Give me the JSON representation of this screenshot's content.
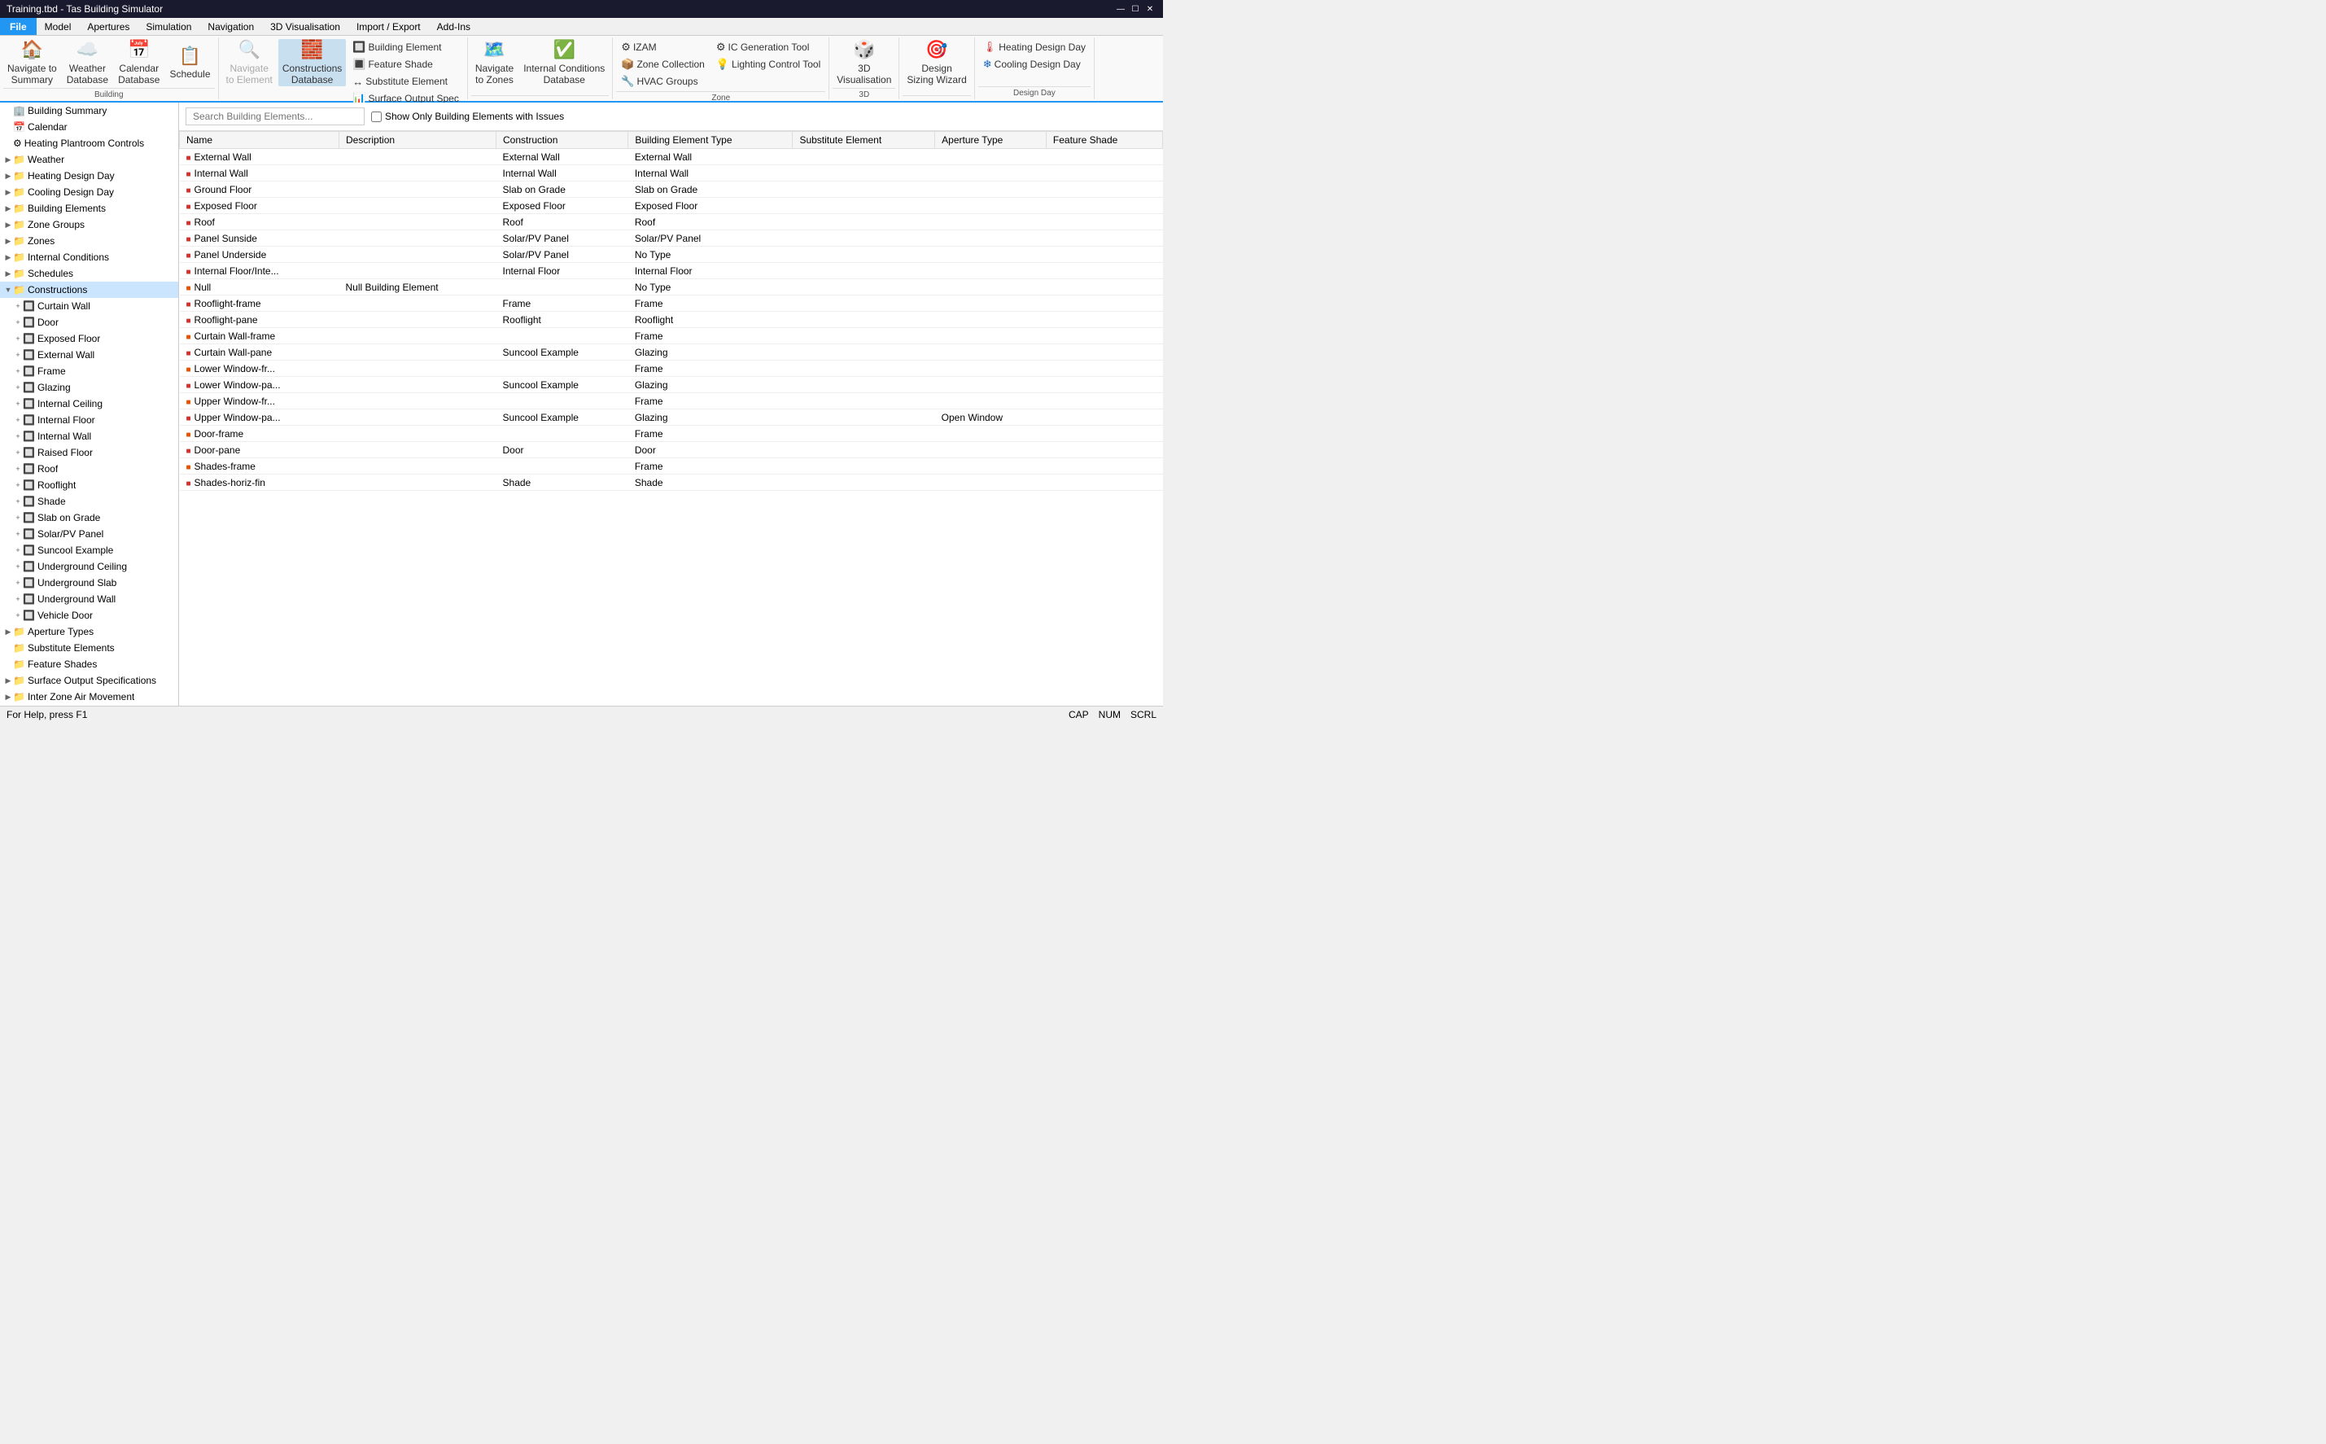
{
  "titlebar": {
    "title": "Training.tbd - Tas Building Simulator",
    "controls": [
      "—",
      "☐",
      "✕"
    ]
  },
  "menubar": {
    "file": "File",
    "items": [
      "Model",
      "Apertures",
      "Simulation",
      "Navigation",
      "3D Visualisation",
      "Import / Export",
      "Add-Ins"
    ]
  },
  "ribbon": {
    "groups": [
      {
        "label": "Building",
        "buttons": [
          {
            "id": "navigate-summary",
            "label": "Navigate to\nSummary",
            "icon": "🏠"
          },
          {
            "id": "weather",
            "label": "Weather\nDatabase",
            "icon": "☁"
          },
          {
            "id": "calendar",
            "label": "Calendar\nDatabase",
            "icon": "📅"
          },
          {
            "id": "schedule",
            "label": "Schedule",
            "icon": "📋"
          }
        ]
      },
      {
        "label": "Building Element",
        "buttons": [
          {
            "id": "navigate-element",
            "label": "Navigate\nto Element",
            "icon": "🔍",
            "disabled": false
          },
          {
            "id": "constructions-db",
            "label": "Constructions\nDatabase",
            "icon": "🧱",
            "active": true
          }
        ],
        "small_buttons": [
          {
            "id": "building-element",
            "label": "Building Element",
            "icon": "🔲"
          },
          {
            "id": "feature-shade",
            "label": "Feature Shade",
            "icon": "🔳"
          },
          {
            "id": "substitute-element",
            "label": "Substitute Element",
            "icon": "↔"
          },
          {
            "id": "surface-output-spec",
            "label": "Surface Output Spec",
            "icon": "📊"
          }
        ]
      },
      {
        "label": "",
        "buttons": [
          {
            "id": "navigate-zones",
            "label": "Navigate\nto Zones",
            "icon": "🗺"
          },
          {
            "id": "internal-conditions",
            "label": "Internal Conditions\nDatabase",
            "icon": "✅"
          }
        ]
      },
      {
        "label": "Zone",
        "small_buttons": [
          {
            "id": "izam",
            "label": "IZAM",
            "icon": "⚙"
          },
          {
            "id": "zone-collection",
            "label": "Zone Collection",
            "icon": "📦"
          },
          {
            "id": "hvac-groups",
            "label": "HVAC Groups",
            "icon": "🔧"
          },
          {
            "id": "ic-gen-tool",
            "label": "IC Generation Tool",
            "icon": "⚙"
          },
          {
            "id": "lighting-control",
            "label": "Lighting Control Tool",
            "icon": "💡"
          }
        ]
      },
      {
        "label": "3D",
        "buttons": [
          {
            "id": "3d-vis",
            "label": "3D\nVisualisation",
            "icon": "🎲"
          }
        ],
        "small_extra": [
          {
            "id": "design-sizing",
            "label": "Design\nSizing Wizard",
            "icon": "🎯"
          }
        ]
      },
      {
        "label": "Design Day",
        "small_buttons": [
          {
            "id": "heating-design-day",
            "label": "Heating Design Day",
            "icon": "🔴"
          },
          {
            "id": "cooling-design-day",
            "label": "Cooling Design Day",
            "icon": "🔵"
          }
        ]
      }
    ]
  },
  "sidebar": {
    "items": [
      {
        "label": "Building Summary",
        "icon": "🏢",
        "indent": 0,
        "expand": ""
      },
      {
        "label": "Calendar",
        "icon": "📅",
        "indent": 0,
        "expand": ""
      },
      {
        "label": "Heating Plantroom Controls",
        "icon": "⚙",
        "indent": 0,
        "expand": ""
      },
      {
        "label": "Weather",
        "icon": "📁",
        "indent": 0,
        "expand": "▶"
      },
      {
        "label": "Heating Design Day",
        "icon": "📁",
        "indent": 0,
        "expand": "▶"
      },
      {
        "label": "Cooling Design Day",
        "icon": "📁",
        "indent": 0,
        "expand": "▶"
      },
      {
        "label": "Building Elements",
        "icon": "📁",
        "indent": 0,
        "expand": "▶"
      },
      {
        "label": "Zone Groups",
        "icon": "📁",
        "indent": 0,
        "expand": "▶"
      },
      {
        "label": "Zones",
        "icon": "📁",
        "indent": 0,
        "expand": "▶"
      },
      {
        "label": "Internal Conditions",
        "icon": "📁",
        "indent": 0,
        "expand": "▶"
      },
      {
        "label": "Schedules",
        "icon": "📁",
        "indent": 0,
        "expand": "▶"
      },
      {
        "label": "Constructions",
        "icon": "📁",
        "indent": 0,
        "expand": "▼",
        "selected": true
      },
      {
        "label": "Curtain Wall",
        "icon": "🔲",
        "indent": 1,
        "expand": "+"
      },
      {
        "label": "Door",
        "icon": "🔲",
        "indent": 1,
        "expand": "+"
      },
      {
        "label": "Exposed Floor",
        "icon": "🔲",
        "indent": 1,
        "expand": "+"
      },
      {
        "label": "External Wall",
        "icon": "🔲",
        "indent": 1,
        "expand": "+"
      },
      {
        "label": "Frame",
        "icon": "🔲",
        "indent": 1,
        "expand": "+"
      },
      {
        "label": "Glazing",
        "icon": "🔲",
        "indent": 1,
        "expand": "+"
      },
      {
        "label": "Internal Ceiling",
        "icon": "🔲",
        "indent": 1,
        "expand": "+"
      },
      {
        "label": "Internal Floor",
        "icon": "🔲",
        "indent": 1,
        "expand": "+"
      },
      {
        "label": "Internal Wall",
        "icon": "🔲",
        "indent": 1,
        "expand": "+"
      },
      {
        "label": "Raised Floor",
        "icon": "🔲",
        "indent": 1,
        "expand": "+"
      },
      {
        "label": "Roof",
        "icon": "🔲",
        "indent": 1,
        "expand": "+"
      },
      {
        "label": "Rooflight",
        "icon": "🔲",
        "indent": 1,
        "expand": "+"
      },
      {
        "label": "Shade",
        "icon": "🔲",
        "indent": 1,
        "expand": "+"
      },
      {
        "label": "Slab on Grade",
        "icon": "🔲",
        "indent": 1,
        "expand": "+"
      },
      {
        "label": "Solar/PV Panel",
        "icon": "🔲",
        "indent": 1,
        "expand": "+"
      },
      {
        "label": "Suncool Example",
        "icon": "🔲",
        "indent": 1,
        "expand": "+"
      },
      {
        "label": "Underground Ceiling",
        "icon": "🔲",
        "indent": 1,
        "expand": "+"
      },
      {
        "label": "Underground Slab",
        "icon": "🔲",
        "indent": 1,
        "expand": "+"
      },
      {
        "label": "Underground Wall",
        "icon": "🔲",
        "indent": 1,
        "expand": "+"
      },
      {
        "label": "Vehicle Door",
        "icon": "🔲",
        "indent": 1,
        "expand": "+"
      },
      {
        "label": "Aperture Types",
        "icon": "📁",
        "indent": 0,
        "expand": "▶"
      },
      {
        "label": "Substitute Elements",
        "icon": "📁",
        "indent": 0,
        "expand": ""
      },
      {
        "label": "Feature Shades",
        "icon": "📁",
        "indent": 0,
        "expand": ""
      },
      {
        "label": "Surface Output Specifications",
        "icon": "📁",
        "indent": 0,
        "expand": "▶"
      },
      {
        "label": "Inter Zone Air Movement",
        "icon": "📁",
        "indent": 0,
        "expand": "▶"
      }
    ]
  },
  "content": {
    "search_placeholder": "Search Building Elements...",
    "checkbox_label": "Show Only Building Elements with Issues",
    "columns": [
      "Name",
      "Description",
      "Construction",
      "Building Element Type",
      "Substitute Element",
      "Aperture Type",
      "Feature Shade"
    ],
    "rows": [
      {
        "name": "External Wall",
        "description": "",
        "construction": "External Wall",
        "type": "External Wall",
        "substitute": "",
        "aperture": "",
        "shade": "",
        "icon_type": "red"
      },
      {
        "name": "Internal Wall",
        "description": "",
        "construction": "Internal Wall",
        "type": "Internal Wall",
        "substitute": "",
        "aperture": "",
        "shade": "",
        "icon_type": "red"
      },
      {
        "name": "Ground Floor",
        "description": "",
        "construction": "Slab on Grade",
        "type": "Slab on Grade",
        "substitute": "",
        "aperture": "",
        "shade": "",
        "icon_type": "red"
      },
      {
        "name": "Exposed Floor",
        "description": "",
        "construction": "Exposed Floor",
        "type": "Exposed Floor",
        "substitute": "",
        "aperture": "",
        "shade": "",
        "icon_type": "red"
      },
      {
        "name": "Roof",
        "description": "",
        "construction": "Roof",
        "type": "Roof",
        "substitute": "",
        "aperture": "",
        "shade": "",
        "icon_type": "red"
      },
      {
        "name": "Panel Sunside",
        "description": "",
        "construction": "Solar/PV Panel",
        "type": "Solar/PV Panel",
        "substitute": "",
        "aperture": "",
        "shade": "",
        "icon_type": "red"
      },
      {
        "name": "Panel Underside",
        "description": "",
        "construction": "Solar/PV Panel",
        "type": "No Type",
        "substitute": "",
        "aperture": "",
        "shade": "",
        "icon_type": "red"
      },
      {
        "name": "Internal Floor/Inte...",
        "description": "",
        "construction": "Internal Floor",
        "type": "Internal Floor",
        "substitute": "",
        "aperture": "",
        "shade": "",
        "icon_type": "red"
      },
      {
        "name": "Null",
        "description": "Null Building Element",
        "construction": "",
        "type": "No Type",
        "substitute": "",
        "aperture": "",
        "shade": "",
        "icon_type": "orange"
      },
      {
        "name": "Rooflight-frame",
        "description": "",
        "construction": "Frame",
        "type": "Frame",
        "substitute": "",
        "aperture": "",
        "shade": "",
        "icon_type": "red"
      },
      {
        "name": "Rooflight-pane",
        "description": "",
        "construction": "Rooflight",
        "type": "Rooflight",
        "substitute": "",
        "aperture": "",
        "shade": "",
        "icon_type": "red"
      },
      {
        "name": "Curtain Wall-frame",
        "description": "",
        "construction": "",
        "type": "Frame",
        "substitute": "",
        "aperture": "",
        "shade": "",
        "icon_type": "orange"
      },
      {
        "name": "Curtain Wall-pane",
        "description": "",
        "construction": "Suncool Example",
        "type": "Glazing",
        "substitute": "",
        "aperture": "",
        "shade": "",
        "icon_type": "red"
      },
      {
        "name": "Lower Window-fr...",
        "description": "",
        "construction": "",
        "type": "Frame",
        "substitute": "",
        "aperture": "",
        "shade": "",
        "icon_type": "orange"
      },
      {
        "name": "Lower Window-pa...",
        "description": "",
        "construction": "Suncool Example",
        "type": "Glazing",
        "substitute": "",
        "aperture": "",
        "shade": "",
        "icon_type": "red"
      },
      {
        "name": "Upper Window-fr...",
        "description": "",
        "construction": "",
        "type": "Frame",
        "substitute": "",
        "aperture": "",
        "shade": "",
        "icon_type": "orange"
      },
      {
        "name": "Upper Window-pa...",
        "description": "",
        "construction": "Suncool Example",
        "type": "Glazing",
        "substitute": "",
        "aperture": "Open Window",
        "shade": "",
        "icon_type": "red"
      },
      {
        "name": "Door-frame",
        "description": "",
        "construction": "",
        "type": "Frame",
        "substitute": "",
        "aperture": "",
        "shade": "",
        "icon_type": "orange"
      },
      {
        "name": "Door-pane",
        "description": "",
        "construction": "Door",
        "type": "Door",
        "substitute": "",
        "aperture": "",
        "shade": "",
        "icon_type": "red"
      },
      {
        "name": "Shades-frame",
        "description": "",
        "construction": "",
        "type": "Frame",
        "substitute": "",
        "aperture": "",
        "shade": "",
        "icon_type": "orange"
      },
      {
        "name": "Shades-horiz-fin",
        "description": "",
        "construction": "Shade",
        "type": "Shade",
        "substitute": "",
        "aperture": "",
        "shade": "",
        "icon_type": "red"
      }
    ]
  },
  "statusbar": {
    "left": "For Help, press F1",
    "right": [
      "CAP",
      "NUM",
      "SCRL"
    ]
  }
}
